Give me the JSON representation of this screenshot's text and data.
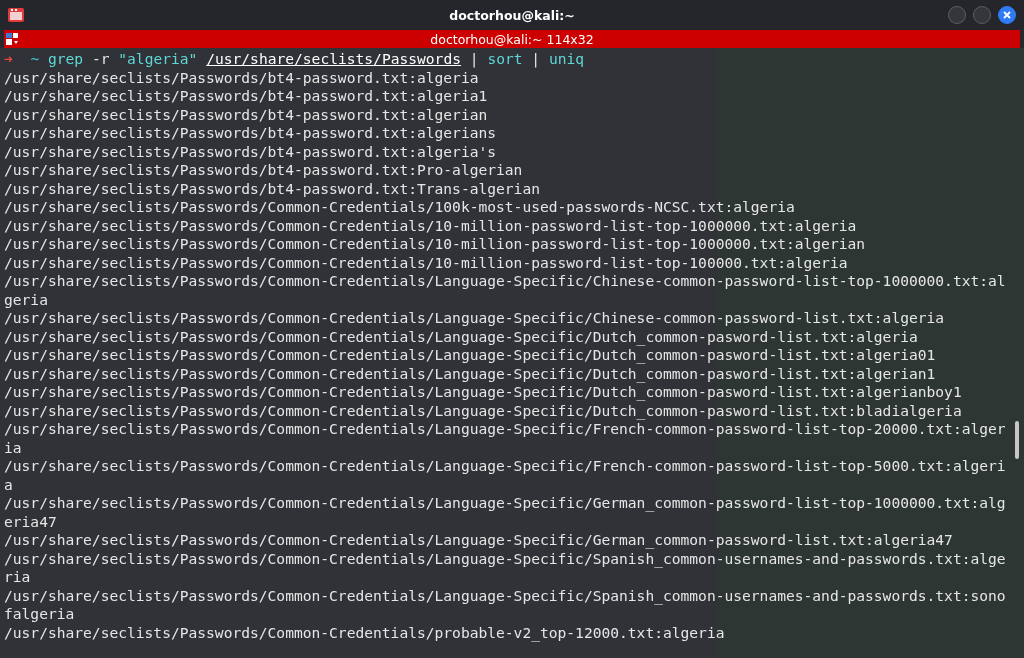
{
  "window": {
    "title": "doctorhou@kali:~"
  },
  "tab_bar": {
    "title": "doctorhou@kali:~ 114x32"
  },
  "prompt": {
    "symbol": "➜",
    "tokens": [
      {
        "text": "~",
        "kind": "dir"
      },
      {
        "text": "grep",
        "kind": "command"
      },
      {
        "text": "-r",
        "kind": "arg"
      },
      {
        "text": "\"algeria\"",
        "kind": "string"
      },
      {
        "text": "/usr/share/seclists/Passwords",
        "kind": "path"
      },
      {
        "text": "|",
        "kind": "pipe"
      },
      {
        "text": "sort",
        "kind": "command"
      },
      {
        "text": "|",
        "kind": "pipe"
      },
      {
        "text": "uniq",
        "kind": "command"
      }
    ]
  },
  "output": [
    "/usr/share/seclists/Passwords/bt4-password.txt:algeria",
    "/usr/share/seclists/Passwords/bt4-password.txt:algeria1",
    "/usr/share/seclists/Passwords/bt4-password.txt:algerian",
    "/usr/share/seclists/Passwords/bt4-password.txt:algerians",
    "/usr/share/seclists/Passwords/bt4-password.txt:algeria's",
    "/usr/share/seclists/Passwords/bt4-password.txt:Pro-algerian",
    "/usr/share/seclists/Passwords/bt4-password.txt:Trans-algerian",
    "/usr/share/seclists/Passwords/Common-Credentials/100k-most-used-passwords-NCSC.txt:algeria",
    "/usr/share/seclists/Passwords/Common-Credentials/10-million-password-list-top-1000000.txt:algeria",
    "/usr/share/seclists/Passwords/Common-Credentials/10-million-password-list-top-1000000.txt:algerian",
    "/usr/share/seclists/Passwords/Common-Credentials/10-million-password-list-top-100000.txt:algeria",
    "/usr/share/seclists/Passwords/Common-Credentials/Language-Specific/Chinese-common-password-list-top-1000000.txt:algeria",
    "/usr/share/seclists/Passwords/Common-Credentials/Language-Specific/Chinese-common-password-list.txt:algeria",
    "/usr/share/seclists/Passwords/Common-Credentials/Language-Specific/Dutch_common-pasword-list.txt:algeria",
    "/usr/share/seclists/Passwords/Common-Credentials/Language-Specific/Dutch_common-pasword-list.txt:algeria01",
    "/usr/share/seclists/Passwords/Common-Credentials/Language-Specific/Dutch_common-pasword-list.txt:algerian1",
    "/usr/share/seclists/Passwords/Common-Credentials/Language-Specific/Dutch_common-pasword-list.txt:algerianboy1",
    "/usr/share/seclists/Passwords/Common-Credentials/Language-Specific/Dutch_common-pasword-list.txt:bladialgeria",
    "/usr/share/seclists/Passwords/Common-Credentials/Language-Specific/French-common-password-list-top-20000.txt:algeria",
    "/usr/share/seclists/Passwords/Common-Credentials/Language-Specific/French-common-password-list-top-5000.txt:algeria",
    "/usr/share/seclists/Passwords/Common-Credentials/Language-Specific/German_common-password-list-top-1000000.txt:algeria47",
    "/usr/share/seclists/Passwords/Common-Credentials/Language-Specific/German_common-password-list.txt:algeria47",
    "/usr/share/seclists/Passwords/Common-Credentials/Language-Specific/Spanish_common-usernames-and-passwords.txt:algeria",
    "/usr/share/seclists/Passwords/Common-Credentials/Language-Specific/Spanish_common-usernames-and-passwords.txt:sonofalgeria",
    "/usr/share/seclists/Passwords/Common-Credentials/probable-v2_top-12000.txt:algeria"
  ]
}
